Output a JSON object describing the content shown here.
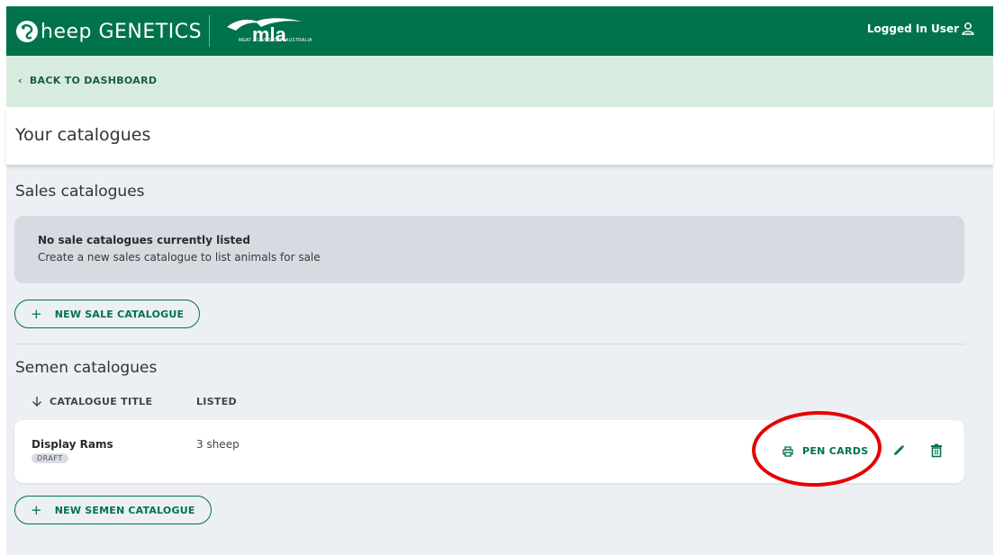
{
  "header": {
    "brand_text": "heep GENETICS",
    "partner_logo_text": "mla",
    "partner_logo_subtitle": "MEAT & LIVESTOCK AUSTRALIA",
    "user_label": "Logged In User",
    "icons": {
      "brand": "sheep-logo-icon",
      "user": "user-icon"
    }
  },
  "nav": {
    "back_label": "BACK TO DASHBOARD",
    "back_icon": "chevron-left-icon"
  },
  "page": {
    "title": "Your catalogues"
  },
  "sales": {
    "title": "Sales catalogues",
    "empty_title": "No sale catalogues currently listed",
    "empty_desc": "Create a new sales catalogue to list animals for sale",
    "new_button": "NEW SALE CATALOGUE"
  },
  "semen": {
    "title": "Semen catalogues",
    "columns": [
      "CATALOGUE TITLE",
      "LISTED"
    ],
    "sort_icon": "arrow-down-icon",
    "rows": [
      {
        "title": "Display Rams",
        "status": "DRAFT",
        "listed": "3 sheep",
        "pen_cards_label": "PEN CARDS",
        "icons": [
          "printer-icon",
          "edit-icon",
          "trash-icon"
        ]
      }
    ],
    "new_button": "NEW SEMEN CATALOGUE"
  },
  "colors": {
    "brand_green": "#00734a",
    "back_bar": "#d8ebdf",
    "main_bg": "#eceff3",
    "annotation": "#e60000"
  }
}
